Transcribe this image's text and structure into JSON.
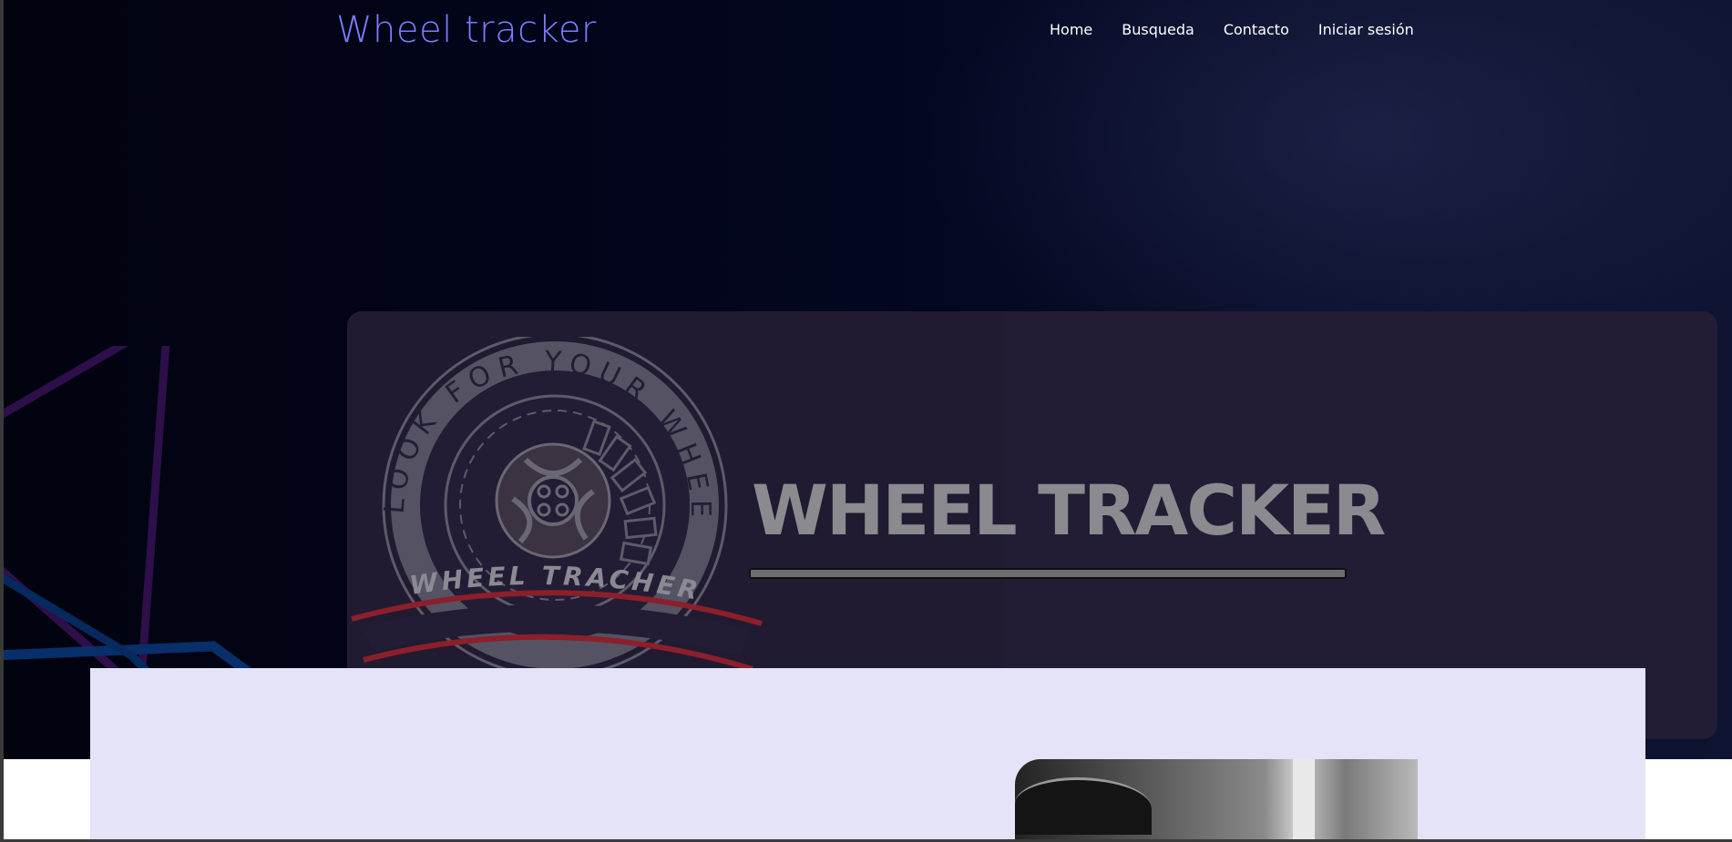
{
  "header": {
    "brand": "Wheel tracker",
    "nav": [
      {
        "label": "Home"
      },
      {
        "label": "Busqueda"
      },
      {
        "label": "Contacto"
      },
      {
        "label": "Iniciar sesión"
      }
    ]
  },
  "banner": {
    "logo_ring_text": "LOOK FOR YOUR WHEELS",
    "logo_ribbon_text": "WHEEL TRACHER",
    "logo_title": "WHEEL TRACKER"
  },
  "colors": {
    "brand": "#7b7cff",
    "hero_background": "#030620",
    "banner_background": "#221d34",
    "content_panel": "#e4e3f7",
    "ribbon_red": "#8c1f2a"
  },
  "icons": [
    "wheel-icon"
  ]
}
